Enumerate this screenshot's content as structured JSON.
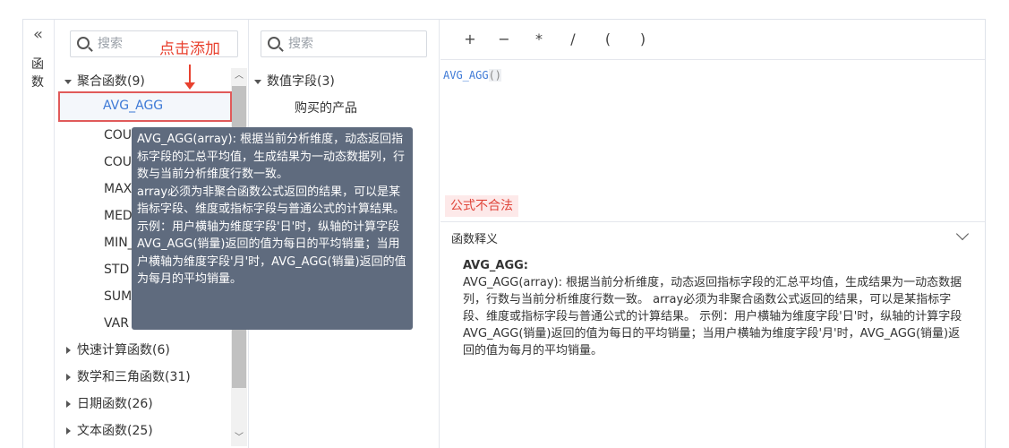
{
  "rail": {
    "label": "函数"
  },
  "functions": {
    "search_placeholder": "搜索",
    "groups": [
      {
        "label": "聚合函数(9)",
        "expanded": true
      },
      {
        "label": "快速计算函数(6)",
        "expanded": false
      },
      {
        "label": "数学和三角函数(31)",
        "expanded": false
      },
      {
        "label": "日期函数(26)",
        "expanded": false
      },
      {
        "label": "文本函数(25)",
        "expanded": false
      }
    ],
    "items": [
      "AVG_AGG",
      "COU",
      "COU",
      "MAX",
      "MED",
      "MIN_",
      "STD",
      "SUM",
      "VAR"
    ],
    "selected": "AVG_AGG"
  },
  "annotation": {
    "text": "点击添加"
  },
  "fields": {
    "search_placeholder": "搜索",
    "group": "数值字段(3)",
    "items": [
      "购买的产品"
    ]
  },
  "toolbar": {
    "ops": [
      "+",
      "−",
      "*",
      "/",
      "(",
      ")"
    ]
  },
  "editor": {
    "formula_name": "AVG_AGG",
    "formula_parens": "()",
    "invalid_label": "公式不合法"
  },
  "description": {
    "header": "函数释义",
    "name": "AVG_AGG:",
    "text": "AVG_AGG(array): 根据当前分析维度，动态返回指标字段的汇总平均值，生成结果为一动态数据列，行数与当前分析维度行数一致。  array必须为非聚合函数公式返回的结果，可以是某指标字段、维度或指标字段与普通公式的计算结果。  示例：用户横轴为维度字段'日'时，纵轴的计算字段AVG_AGG(销量)返回的值为每日的平均销量；当用户横轴为维度字段'月'时，AVG_AGG(销量)返回的值为每月的平均销量。"
  },
  "tooltip": {
    "text": "AVG_AGG(array): 根据当前分析维度，动态返回指标字段的汇总平均值，生成结果为一动态数据列，行数与当前分析维度行数一致。\n array必须为非聚合函数公式返回的结果，可以是某指标字段、维度或指标字段与普通公式的计算结果。\n 示例：用户横轴为维度字段'日'时，纵轴的计算字段AVG_AGG(销量)返回的值为每日的平均销量；当用户横轴为维度字段'月'时，AVG_AGG(销量)返回的值为每月的平均销量。"
  }
}
